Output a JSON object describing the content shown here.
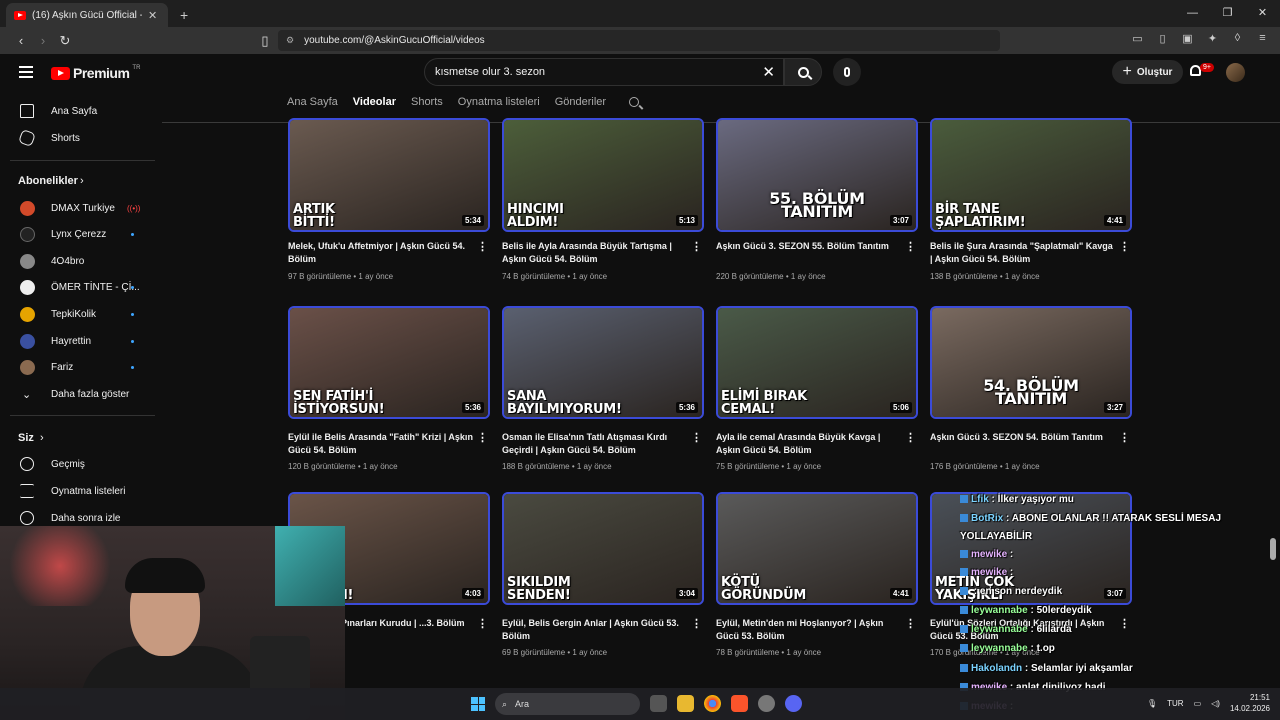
{
  "browser": {
    "tab_title": "(16) Aşkın Gücü Official - YouTube",
    "url": "youtube.com/@AskinGucuOfficial/videos"
  },
  "header": {
    "logo_text": "Premium",
    "logo_sup": "TR",
    "search_value": "kısmetse olur 3. sezon",
    "create_label": "Oluştur",
    "notif_badge": "9+"
  },
  "channel_tabs": [
    "Ana Sayfa",
    "Videolar",
    "Shorts",
    "Oynatma listeleri",
    "Gönderiler"
  ],
  "sidebar": {
    "home": "Ana Sayfa",
    "shorts": "Shorts",
    "subs_heading": "Abonelikler",
    "subs": [
      "DMAX Turkiye",
      "Lynx Çerezz",
      "4O4bro",
      "ÖMER TİNTE - Çİ...",
      "TepkiKolik",
      "Hayrettin",
      "Fariz"
    ],
    "show_more": "Daha fazla göster",
    "you_heading": "Siz",
    "history": "Geçmiş",
    "playlists": "Oynatma listeleri",
    "watch_later": "Daha sonra izle"
  },
  "videos": [
    {
      "overlay": "ARTIK\nBİTTİ!",
      "duration": "5:34",
      "title": "Melek, Ufuk'u Affetmiyor | Aşkın Gücü 54. Bölüm",
      "views": "97 B görüntüleme",
      "age": "1 ay önce",
      "bg": "#6a5a50"
    },
    {
      "overlay": "HINCIMI\nALDIM!",
      "duration": "5:13",
      "title": "Belis ile Ayla Arasında Büyük Tartışma | Aşkın Gücü 54. Bölüm",
      "views": "74 B görüntüleme",
      "age": "1 ay önce",
      "bg": "#4c5e3a"
    },
    {
      "overlay": "55. BÖLÜM\nTANITIM",
      "duration": "3:07",
      "title": "Aşkın Gücü 3. SEZON 55. Bölüm Tanıtım",
      "views": "220 B görüntüleme",
      "age": "1 ay önce",
      "bg": "#6a6a80"
    },
    {
      "overlay": "BİR TANE\nŞAPLATIRIM!",
      "duration": "4:41",
      "title": "Belis ile Şura Arasında \"Şaplatmalı\" Kavga | Aşkın Gücü 54. Bölüm",
      "views": "138 B görüntüleme",
      "age": "1 ay önce",
      "bg": "#4a5c3c"
    },
    {
      "overlay": "SEN FATİH'İ\nİSTİYORSUN!",
      "duration": "5:36",
      "title": "Eylül ile Belis Arasında \"Fatih\" Krizi | Aşkın Gücü 54. Bölüm",
      "views": "120 B görüntüleme",
      "age": "1 ay önce",
      "bg": "#6a5048"
    },
    {
      "overlay": "SANA\nBAYILMIYORUM!",
      "duration": "5:36",
      "title": "Osman ile Elisa'nın Tatlı Atışması Kırdı Geçirdi | Aşkın Gücü 54. Bölüm",
      "views": "188 B görüntüleme",
      "age": "1 ay önce",
      "bg": "#5a6070"
    },
    {
      "overlay": "ELİMİ BIRAK\nCEMAL!",
      "duration": "5:06",
      "title": "Ayla ile cemal Arasında Büyük Kavga | Aşkın Gücü 54. Bölüm",
      "views": "75 B görüntüleme",
      "age": "1 ay önce",
      "bg": "#4a5a48"
    },
    {
      "overlay": "54. BÖLÜM\nTANITIM",
      "duration": "3:27",
      "title": "Aşkın Gücü 3. SEZON 54. Bölüm Tanıtım",
      "views": "176 B görüntüleme",
      "age": "1 ay önce",
      "bg": "#7a6a60"
    },
    {
      "overlay": "ÇAKTIM!",
      "duration": "4:03",
      "title": "...aktan Göz Pınarları Kurudu | ...3. Bölüm",
      "views": "",
      "age": "1 ay önce",
      "bg": "#6a5448"
    },
    {
      "overlay": "SIKILDIM\nSENDEN!",
      "duration": "3:04",
      "title": "Eylül, Belis Gergin Anlar | Aşkın Gücü 53. Bölüm",
      "views": "69 B görüntüleme",
      "age": "1 ay önce",
      "bg": "#4a4a40"
    },
    {
      "overlay": "KÖTÜ\nGÖRÜNDÜM",
      "duration": "4:41",
      "title": "Eylül, Metin'den mi Hoşlanıyor? | Aşkın Gücü 53. Bölüm",
      "views": "78 B görüntüleme",
      "age": "1 ay önce",
      "bg": "#5a5a5a"
    },
    {
      "overlay": "METİN ÇOK\nYAKIŞIKLI",
      "duration": "3:07",
      "title": "Eylül'ün Sözleri Ortalığı Karıştırdı | Aşkın Gücü 53. Bölüm",
      "views": "170 B görüntüleme",
      "age": "1 ay önce",
      "bg": "#4a5058"
    }
  ],
  "chat": [
    {
      "user": "Lfik",
      "msg": "İlker yaşıyor mu"
    },
    {
      "user": "BotRix",
      "msg": "ABONE OLANLAR !! ATARAK SESLİ MESAJ"
    },
    {
      "user": "",
      "msg": "YOLLAYABİLİR"
    },
    {
      "user": "mewike",
      "msg": ""
    },
    {
      "user": "mewike",
      "msg": ""
    },
    {
      "user": "",
      "msg": "en son nerdeydik"
    },
    {
      "user": "leywannabe",
      "msg": "50lerdeydik"
    },
    {
      "user": "leywannabe",
      "msg": "6lilarda"
    },
    {
      "user": "leywannabe",
      "msg": "t.op"
    },
    {
      "user": "Hakolandn",
      "msg": "Selamlar iyi akşamlar"
    },
    {
      "user": "mewike",
      "msg": "anlat diniliyoz hadi"
    },
    {
      "user": "mewike",
      "msg": ""
    }
  ],
  "taskbar": {
    "search": "Ara",
    "lang": "TUR",
    "time": "21:51",
    "date": "14.02.2026"
  }
}
